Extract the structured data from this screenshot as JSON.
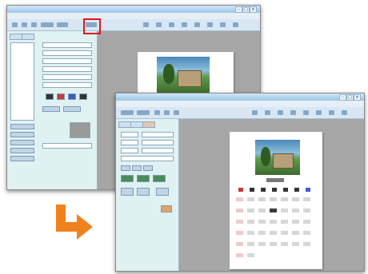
{
  "window_back": {
    "menu_items": [
      "",
      "",
      "",
      "",
      ""
    ],
    "month_label": ""
  },
  "window_front": {
    "menu_items": [
      "",
      "",
      "",
      "",
      ""
    ],
    "month_label": ""
  },
  "arrow": {
    "color": "#f0821e",
    "icon": "arrow-down-right-icon"
  },
  "highlight": {
    "color": "#e3141b"
  }
}
